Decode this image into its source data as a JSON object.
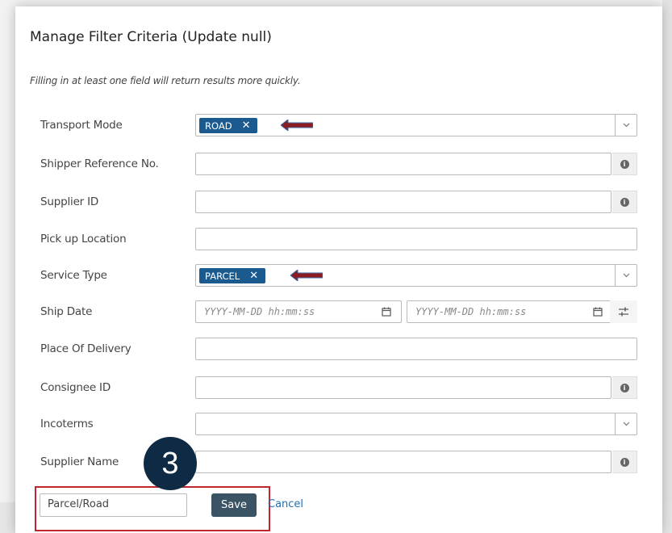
{
  "dialog": {
    "title": "Manage Filter Criteria (Update null)",
    "hint": "Filling in at least one field will return results more quickly."
  },
  "fields": {
    "transport_mode": {
      "label": "Transport Mode",
      "tag": "ROAD",
      "tag_remove": "✕"
    },
    "shipper_ref": {
      "label": "Shipper Reference No.",
      "value": ""
    },
    "supplier_id": {
      "label": "Supplier ID",
      "value": ""
    },
    "pickup_location": {
      "label": "Pick up Location",
      "value": ""
    },
    "service_type": {
      "label": "Service Type",
      "tag": "PARCEL",
      "tag_remove": "✕"
    },
    "ship_date": {
      "label": "Ship Date",
      "from_placeholder": "YYYY-MM-DD hh:mm:ss",
      "to_placeholder": "YYYY-MM-DD hh:mm:ss"
    },
    "place_of_delivery": {
      "label": "Place Of Delivery",
      "value": ""
    },
    "consignee_id": {
      "label": "Consignee ID",
      "value": ""
    },
    "incoterms": {
      "label": "Incoterms",
      "value": ""
    },
    "supplier_name": {
      "label": "Supplier Name",
      "value": ""
    }
  },
  "footer": {
    "filter_name_value": "Parcel/Road",
    "save_label": "Save",
    "cancel_label": "Cancel"
  },
  "annotation": {
    "step_number": "3",
    "highlight_color": "#c0262d",
    "arrow_color": "#8b1c22"
  },
  "colors": {
    "tag_bg": "#1b5a8f",
    "save_bg": "#3a5466",
    "link": "#1f6fb2",
    "badge_bg": "#0f2a44"
  },
  "icons": {
    "info": "info-icon",
    "caret": "chevron-down-icon",
    "calendar": "calendar-icon",
    "sliders": "sliders-icon"
  }
}
